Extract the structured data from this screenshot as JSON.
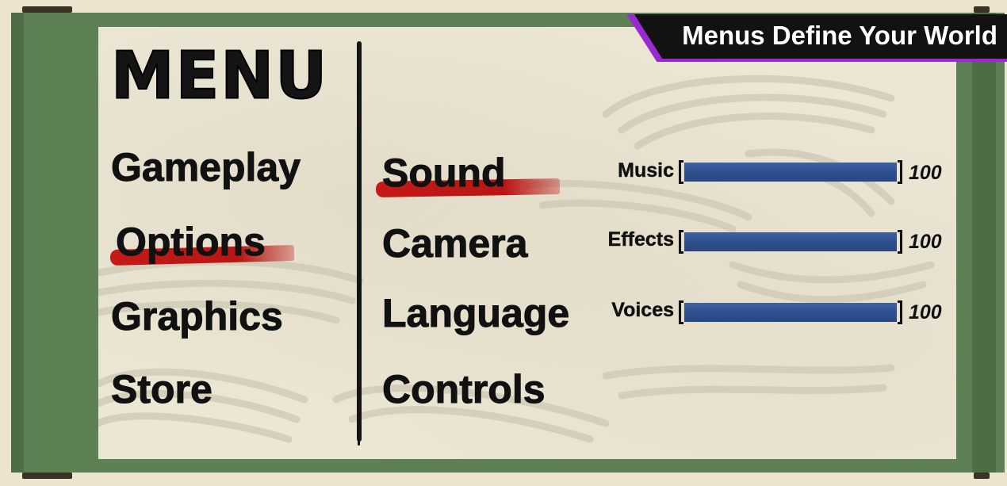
{
  "banner": {
    "text": "Menus Define Your World"
  },
  "menu": {
    "title": "MENU",
    "categories": [
      {
        "label": "Gameplay"
      },
      {
        "label": "Options",
        "selected": true
      },
      {
        "label": "Graphics"
      },
      {
        "label": "Store"
      }
    ],
    "submenu": [
      {
        "label": "Sound",
        "selected": true
      },
      {
        "label": "Camera"
      },
      {
        "label": "Language"
      },
      {
        "label": "Controls"
      }
    ]
  },
  "sliders": [
    {
      "label": "Music",
      "value": "100",
      "level": 1.0
    },
    {
      "label": "Effects",
      "value": "100",
      "level": 1.0
    },
    {
      "label": "Voices",
      "value": "100",
      "level": 1.0
    }
  ],
  "colors": {
    "frame": "#5e8055",
    "paper": "#ece6d5",
    "selection_brush": "#c41a18",
    "slider_fill": "#2f4f8f",
    "banner_accent": "#9a2ad0",
    "banner_bg": "#121212"
  }
}
